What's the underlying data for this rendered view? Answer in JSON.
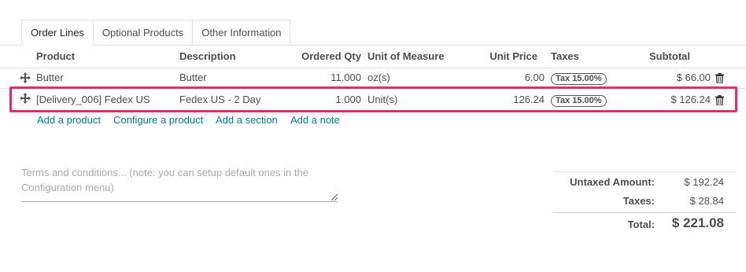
{
  "tabs": [
    {
      "label": "Order Lines",
      "active": true
    },
    {
      "label": "Optional Products",
      "active": false
    },
    {
      "label": "Other Information",
      "active": false
    }
  ],
  "columns": {
    "product": "Product",
    "description": "Description",
    "ordered_qty": "Ordered Qty",
    "uom": "Unit of Measure",
    "unit_price": "Unit Price",
    "taxes": "Taxes",
    "subtotal": "Subtotal"
  },
  "lines": [
    {
      "product": "Butter",
      "description": "Butter",
      "qty": "11.000",
      "uom": "oz(s)",
      "price": "6.00",
      "tax": "Tax 15.00%",
      "subtotal": "$ 66.00"
    },
    {
      "product": "[Delivery_006] Fedex US",
      "description": "Fedex US - 2 Day",
      "qty": "1.000",
      "uom": "Unit(s)",
      "price": "126.24",
      "tax": "Tax 15.00%",
      "subtotal": "$ 126.24",
      "highlighted": true
    }
  ],
  "add_links": {
    "add_product": "Add a product",
    "configure_product": "Configure a product",
    "add_section": "Add a section",
    "add_note": "Add a note"
  },
  "terms_placeholder": "Terms and conditions... (note: you can setup default ones in the Configuration menu)",
  "totals": {
    "untaxed_label": "Untaxed Amount:",
    "untaxed_value": "$ 192.24",
    "taxes_label": "Taxes:",
    "taxes_value": "$ 28.84",
    "total_label": "Total:",
    "total_value": "$ 221.08"
  },
  "colors": {
    "link": "#017e84",
    "highlight": "#d6336c"
  }
}
